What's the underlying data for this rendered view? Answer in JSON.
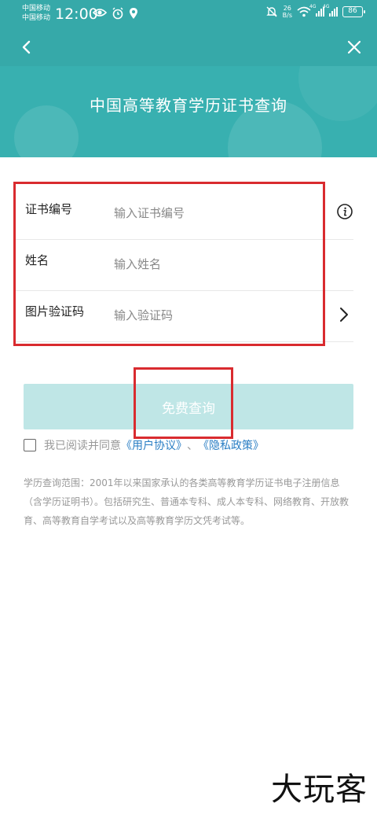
{
  "status_bar": {
    "carrier_1": "中国移动",
    "carrier_2": "中国移动",
    "time": "12:00",
    "net_speed_value": "26",
    "net_speed_unit": "B/s",
    "signal_tech": "4G",
    "battery": "86"
  },
  "page": {
    "title": "中国高等教育学历证书查询"
  },
  "form": {
    "cert_label": "证书编号",
    "cert_placeholder": "输入证书编号",
    "name_label": "姓名",
    "name_placeholder": "输入姓名",
    "captcha_label": "图片验证码",
    "captcha_placeholder": "输入验证码"
  },
  "submit_label": "免费查询",
  "agreement": {
    "prefix": "我已阅读并同意",
    "user_agreement": "《用户协议》",
    "separator": "、",
    "privacy_policy": "《隐私政策》"
  },
  "note": "学历查询范围：2001年以来国家承认的各类高等教育学历证书电子注册信息（含学历证明书）。包括研究生、普通本专科、成人本专科、网络教育、开放教育、高等教育自学考试以及高等教育学历文凭考试等。",
  "watermark": "大玩客",
  "colors": {
    "header_bg": "#36a9a9",
    "button_disabled_bg": "#bfe6e6",
    "link": "#2a7ec4",
    "highlight_box": "#d92b2f"
  },
  "icons": [
    "back-arrow-icon",
    "close-icon",
    "info-icon",
    "chevron-right-icon",
    "eye-icon",
    "alarm-icon",
    "location-icon",
    "mute-icon",
    "wifi-icon",
    "signal-icon",
    "battery-icon"
  ]
}
